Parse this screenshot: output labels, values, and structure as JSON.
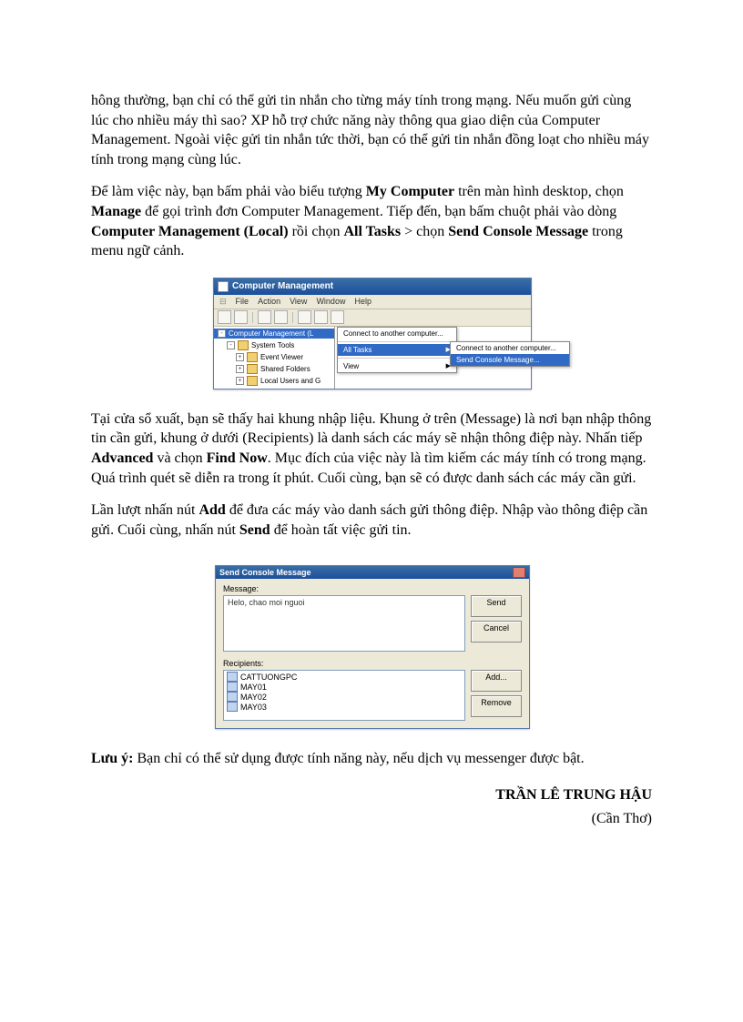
{
  "para1": {
    "t1": "hông thường, bạn chỉ có thể gửi tin nhắn cho từng máy tính trong mạng. Nếu muốn gửi cùng lúc cho nhiều máy thì sao? XP hỗ trợ chức năng này thông qua giao diện của Computer Management. Ngoài việc gửi tin nhắn tức thời, bạn có thể gửi tin nhắn đồng loạt cho nhiều máy tính trong mạng cùng lúc."
  },
  "para2": {
    "t1": "Để làm việc này, bạn bấm phải vào biểu tượng ",
    "b1": "My Computer",
    "t2": " trên màn hình desktop, chọn ",
    "b2": "Manage",
    "t3": " để gọi trình đơn Computer Management. Tiếp đến, bạn bấm chuột phải vào dòng ",
    "b3": "Computer Management (Local)",
    "t4": " rồi chọn ",
    "b4": "All Tasks",
    "t5": " > chọn ",
    "b5": "Send Console Message",
    "t6": " trong menu ngữ cảnh."
  },
  "shot1": {
    "title": "Computer Management",
    "menu": {
      "file": "File",
      "action": "Action",
      "view": "View",
      "window": "Window",
      "help": "Help"
    },
    "tree": {
      "root": "Computer Management (L",
      "i1": "System Tools",
      "i2": "Event Viewer",
      "i3": "Shared Folders",
      "i4": "Local Users and G"
    },
    "ctx1": {
      "i1": "Connect to another computer...",
      "i2": "All Tasks",
      "i3": "View"
    },
    "ctx2": {
      "i1": "Connect to another computer...",
      "i2": "Send Console Message..."
    }
  },
  "para3": {
    "t1": "Tại cửa sổ xuất, bạn sẽ thấy hai khung nhập liệu. Khung ở trên (Message) là nơi bạn nhập thông tin cần gửi, khung ở dưới (Recipients) là danh sách các máy sẽ nhận thông điệp này. Nhấn tiếp ",
    "b1": "Advanced",
    "t2": " và chọn ",
    "b2": "Find Now",
    "t3": ". Mục đích của việc này là tìm kiếm các máy tính có trong mạng. Quá trình quét sẽ diễn ra trong ít phút. Cuối cùng, bạn sẽ có được danh sách các máy cần gửi."
  },
  "para4": {
    "t1": "Lần lượt nhấn nút ",
    "b1": "Add",
    "t2": " để đưa các máy vào danh sách gửi thông điệp. Nhập vào thông điệp cần gửi. Cuối cùng, nhấn nút ",
    "b2": "Send",
    "t3": " để hoàn tất việc gửi tin."
  },
  "shot2": {
    "title": "Send Console Message",
    "msg_label": "Message:",
    "msg_value": "Helo, chao moi nguoi",
    "rec_label": "Recipients:",
    "recipients": [
      "CATTUONGPC",
      "MAY01",
      "MAY02",
      "MAY03"
    ],
    "buttons": {
      "send": "Send",
      "cancel": "Cancel",
      "add": "Add...",
      "remove": "Remove"
    }
  },
  "para5": {
    "b1": "Lưu ý:",
    "t1": " Bạn chỉ có thể sử dụng được tính năng này, nếu dịch vụ messenger được bật."
  },
  "author": "TRẦN LÊ TRUNG HẬU",
  "location": "(Cần Thơ)"
}
